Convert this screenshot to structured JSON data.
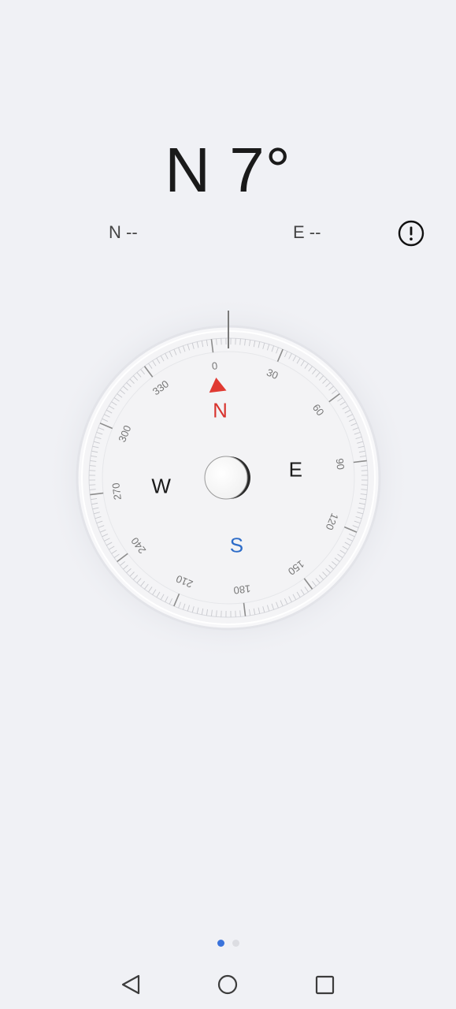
{
  "heading": {
    "direction": "N",
    "degrees": "7°"
  },
  "coordinates": {
    "latitude": "N --",
    "longitude": "E --"
  },
  "info_button": {
    "icon": "info-exclamation-icon"
  },
  "compass": {
    "cardinals": [
      {
        "key": "n",
        "label": "N",
        "color": "#d8332e"
      },
      {
        "key": "e",
        "label": "E",
        "color": "#1a1a1a"
      },
      {
        "key": "s",
        "label": "S",
        "color": "#2d6cc8"
      },
      {
        "key": "w",
        "label": "W",
        "color": "#1a1a1a"
      }
    ],
    "degree_labels": [
      "0",
      "30",
      "60",
      "90",
      "120",
      "150",
      "180",
      "210",
      "240",
      "270",
      "300",
      "330"
    ],
    "rotation_deg": 7,
    "north_marker_color": "#e03a32"
  },
  "pager": {
    "pages": 2,
    "active_index": 0,
    "active_color": "#3a73db"
  },
  "navbar": {
    "back_icon": "back-triangle-icon",
    "home_icon": "home-circle-icon",
    "recent_icon": "recent-square-icon"
  }
}
